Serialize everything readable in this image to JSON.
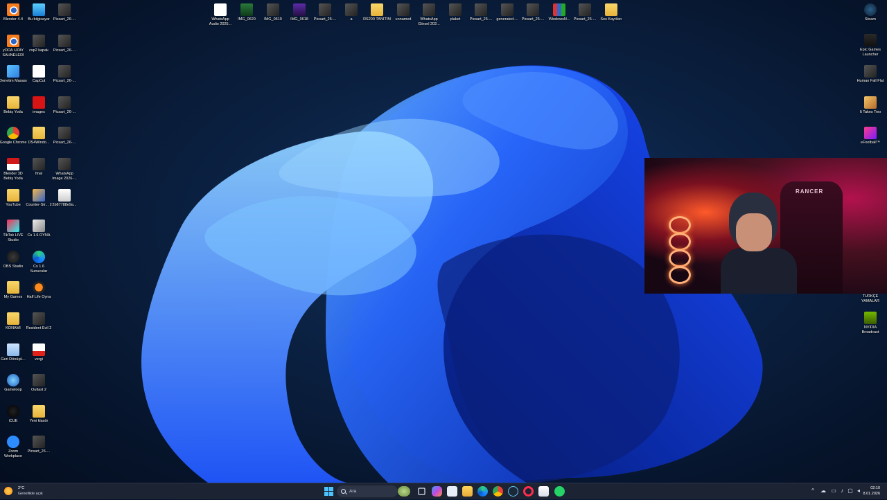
{
  "desktop": {
    "left_col1": [
      {
        "label": "Blender 4.4",
        "kind": "blender"
      },
      {
        "label": "yODA UZAY SAHNELERİ",
        "kind": "blender"
      },
      {
        "label": "Denetim Masası",
        "kind": "control"
      },
      {
        "label": "Bebiş Yoda",
        "kind": "folder"
      },
      {
        "label": "Google Chrome",
        "kind": "chrome"
      },
      {
        "label": "Blender 3D Bebiş Yoda",
        "kind": "flag"
      },
      {
        "label": "YouTube",
        "kind": "folder"
      },
      {
        "label": "TikTok LIVE Studio",
        "kind": "tiktok"
      },
      {
        "label": "OBS Studio",
        "kind": "obs"
      },
      {
        "label": "My Games",
        "kind": "folder"
      },
      {
        "label": "KONAMI",
        "kind": "folder"
      },
      {
        "label": "Geri Dönüşü...",
        "kind": "recycle"
      },
      {
        "label": "Gameloop",
        "kind": "gameloop"
      },
      {
        "label": "iCUE",
        "kind": "icue"
      },
      {
        "label": "Zoom Workplace",
        "kind": "zoom"
      }
    ],
    "left_col2": [
      {
        "label": "Bu bilgisayar",
        "kind": "pc"
      },
      {
        "label": "csp2 kapak",
        "kind": "thumb"
      },
      {
        "label": "CapCut",
        "kind": "capcut"
      },
      {
        "label": "images",
        "kind": "red"
      },
      {
        "label": "DS4Windo...",
        "kind": "folder"
      },
      {
        "label": "final",
        "kind": "thumb"
      },
      {
        "label": "Counter-Str... 2",
        "kind": "cs2"
      },
      {
        "label": "Cs 1.6 OYNA",
        "kind": "cs16"
      },
      {
        "label": "Cs 1.6 Sunucular",
        "kind": "edge"
      },
      {
        "label": "Half Life Oyna",
        "kind": "halflife"
      },
      {
        "label": "Resident Evil 2",
        "kind": "thumb"
      },
      {
        "label": "vergi",
        "kind": "pdf"
      },
      {
        "label": "Outlast 2",
        "kind": "thumb"
      },
      {
        "label": "Yeni klasör",
        "kind": "folder"
      },
      {
        "label": "Picsart_26-...",
        "kind": "thumb"
      }
    ],
    "left_col3": [
      {
        "label": "Picsart_26-...",
        "kind": "thumb"
      },
      {
        "label": "Picsart_26-...",
        "kind": "thumb"
      },
      {
        "label": "Picsart_26-...",
        "kind": "thumb"
      },
      {
        "label": "Picsart_26-...",
        "kind": "thumb"
      },
      {
        "label": "Picsart_26-...",
        "kind": "thumb"
      },
      {
        "label": "WhatsApp Image 2026-...",
        "kind": "thumb"
      },
      {
        "label": "2b87788e9a...",
        "kind": "doc"
      }
    ],
    "top_row": [
      {
        "label": "WhatsApp Audio 2025...",
        "kind": "audio"
      },
      {
        "label": "IMG_0620",
        "kind": "green"
      },
      {
        "label": "IMG_0619",
        "kind": "thumb"
      },
      {
        "label": "IMG_0618",
        "kind": "purple"
      },
      {
        "label": "Picsart_25-...",
        "kind": "thumb"
      },
      {
        "label": "a",
        "kind": "thumb"
      },
      {
        "label": "RS200 TANITIM",
        "kind": "folder"
      },
      {
        "label": "unnamed",
        "kind": "thumb"
      },
      {
        "label": "WhatsApp Görsel 202...",
        "kind": "thumb"
      },
      {
        "label": "plaket",
        "kind": "thumb"
      },
      {
        "label": "Picsart_25-...",
        "kind": "thumb"
      },
      {
        "label": "generated-...",
        "kind": "thumb"
      },
      {
        "label": "Picsart_25-...",
        "kind": "thumb"
      },
      {
        "label": "WindowsN...",
        "kind": "winrar"
      },
      {
        "label": "Picsart_25-...",
        "kind": "thumb"
      },
      {
        "label": "Ses Kayıtları",
        "kind": "folder"
      }
    ],
    "right_col": [
      {
        "label": "Steam",
        "kind": "steam"
      },
      {
        "label": "Epic Games Launcher",
        "kind": "epic"
      },
      {
        "label": "Human Fall Flat",
        "kind": "thumb"
      },
      {
        "label": "It Takes Two",
        "kind": "ittakes"
      },
      {
        "label": "eFootball™",
        "kind": "efootball"
      },
      {
        "label": "TÜRKÇE YAMALAR",
        "kind": "none"
      },
      {
        "label": "NVIDIA Broadcast",
        "kind": "nvidia"
      }
    ]
  },
  "webcam": {
    "chair_brand": "RANCER"
  },
  "taskbar": {
    "weather_temp": "2°C",
    "weather_desc": "Genellikle açık",
    "search_placeholder": "Ara",
    "time": "02:10",
    "date": "8.01.2026"
  },
  "colors": {
    "wallpaper_bloom": "#1d5bff",
    "taskbar_bg": "#1c2333",
    "accent": "#0078d4"
  }
}
